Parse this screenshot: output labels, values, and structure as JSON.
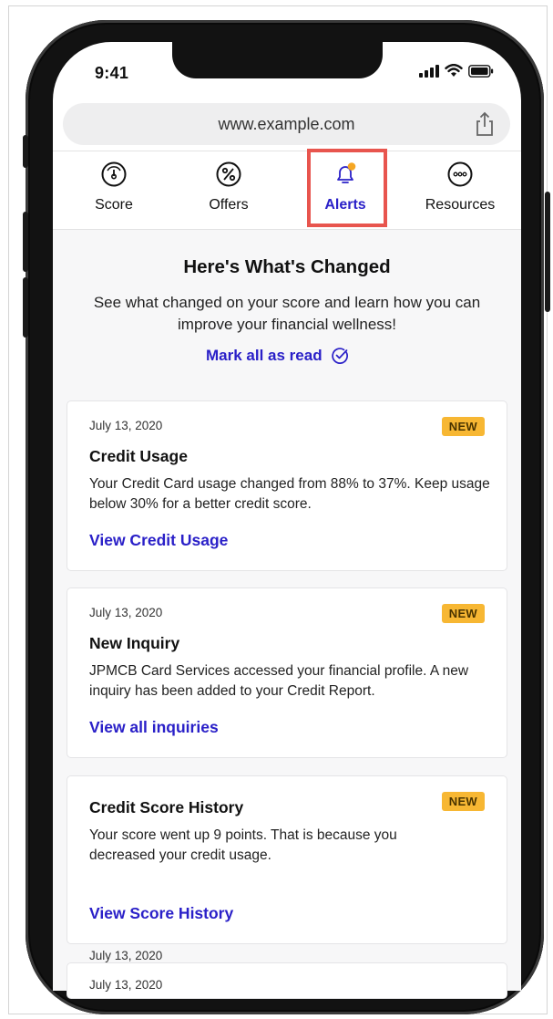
{
  "status": {
    "time": "9:41"
  },
  "browser": {
    "url": "www.example.com"
  },
  "tabs": [
    {
      "label": "Score",
      "icon": "gauge-icon"
    },
    {
      "label": "Offers",
      "icon": "percent-icon"
    },
    {
      "label": "Alerts",
      "icon": "bell-icon",
      "active": true
    },
    {
      "label": "Resources",
      "icon": "more-icon"
    }
  ],
  "colors": {
    "accent": "#2a20c8",
    "badge": "#f7b733",
    "notification_dot": "#f5a623",
    "highlight": "#e8554e"
  },
  "page": {
    "heading": "Here's What's Changed",
    "subtext": "See what changed on your score and learn how you can improve your financial wellness!",
    "mark_all_read": "Mark all as read"
  },
  "alerts": [
    {
      "date": "July 13, 2020",
      "badge": "NEW",
      "title": "Credit Usage",
      "body": "Your Credit Card usage changed from 88% to 37%. Keep usage below 30% for a better credit score.",
      "link": "View Credit Usage"
    },
    {
      "date": "July 13, 2020",
      "badge": "NEW",
      "title": "New Inquiry",
      "body": "JPMCB Card Services accessed your financial profile. A new inquiry has been added to your Credit Report.",
      "link": "View all inquiries"
    },
    {
      "badge": "NEW",
      "title": "Credit Score History",
      "body": "Your score went up 9 points. That is because you decreased your credit usage.",
      "link": "View Score History"
    }
  ],
  "trailing_dates": [
    "July 13, 2020",
    "July 13, 2020"
  ]
}
